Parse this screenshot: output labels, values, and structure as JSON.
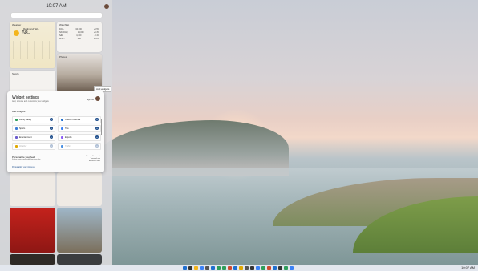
{
  "widgets_panel": {
    "time": "10:07 AM",
    "weather": {
      "title": "Weather",
      "location": "Redmond, WA",
      "temp": "68",
      "unit": "°F"
    },
    "stocks": {
      "title": "Watchlist",
      "rows": [
        {
          "name": "DJIA",
          "value": "34,000",
          "change": "+0.5%"
        },
        {
          "name": "NASDAQ",
          "value": "14,000",
          "change": "+0.3%"
        },
        {
          "name": "S&P",
          "value": "4,400",
          "change": "-0.1%"
        },
        {
          "name": "MSFT",
          "value": "300",
          "change": "+0.8%"
        }
      ]
    },
    "photos": {
      "title": "Photos"
    },
    "sports": {
      "title": "Sports"
    },
    "news": [
      {
        "headline": ""
      },
      {
        "headline": ""
      },
      {
        "headline": ""
      },
      {
        "headline": ""
      },
      {
        "headline": ""
      },
      {
        "headline": ""
      }
    ]
  },
  "tooltip": "Add widgets",
  "settings": {
    "title": "Widget settings",
    "subtitle": "Add, remove and customize your widgets",
    "sign_out": "Sign out",
    "section_label": "Add widgets",
    "items": [
      {
        "label": "Family Safety",
        "color": "#2f9e5b",
        "dimmed": false
      },
      {
        "label": "Outlook Calendar",
        "color": "#1f6fcf",
        "dimmed": false
      },
      {
        "label": "Sports",
        "color": "#3b7bd6",
        "dimmed": false
      },
      {
        "label": "Tips",
        "color": "#3b82f6",
        "dimmed": false
      },
      {
        "label": "Entertainment",
        "color": "#6a5acd",
        "dimmed": false
      },
      {
        "label": "Esports",
        "color": "#8b5cf6",
        "dimmed": false
      },
      {
        "label": "Weather",
        "color": "#e0a800",
        "dimmed": true
      },
      {
        "label": "Traffic",
        "color": "#4a90e2",
        "dimmed": true
      }
    ],
    "feed_title": "Personalize your feed",
    "feed_desc": "Follow topics and publishers you like",
    "feed_link": "Personalize your interests",
    "privacy": [
      "Privacy Statement",
      "Terms of use",
      "Microsoft Start"
    ]
  },
  "taskbar": {
    "icon_colors": [
      "#1f6fcf",
      "#333333",
      "#f3b51c",
      "#3b82f6",
      "#555555",
      "#1f6fcf",
      "#2f9e5b",
      "#2f9e5b",
      "#d04a2f",
      "#1f6fcf",
      "#e0a800",
      "#555555",
      "#333333",
      "#3b82f6",
      "#2f9e5b",
      "#d04a2f",
      "#1f6fcf",
      "#333333",
      "#2f9e5b",
      "#3b82f6"
    ],
    "tray_time": "10:07 AM"
  }
}
